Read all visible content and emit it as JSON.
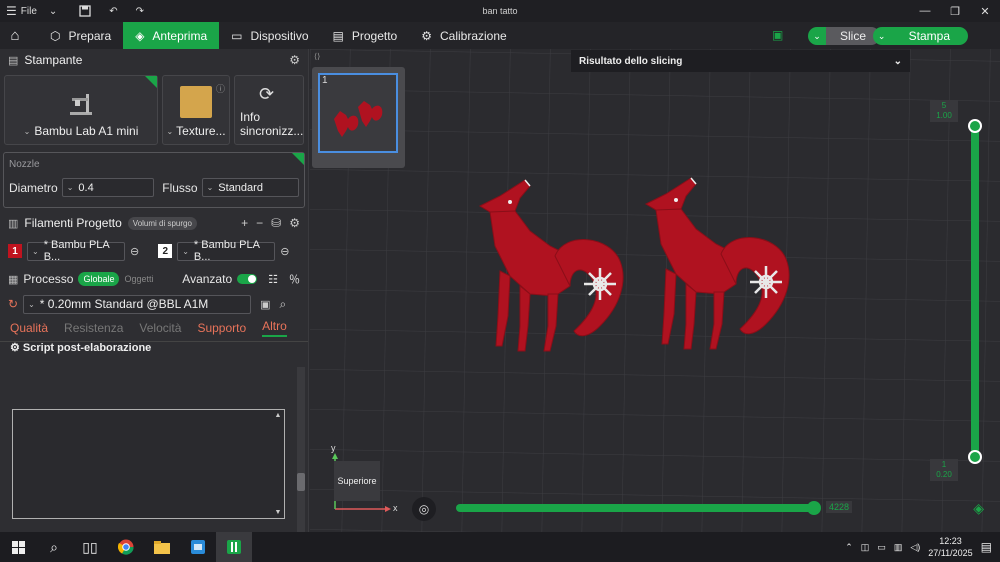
{
  "window": {
    "menu_label": "File",
    "title": "ban tatto"
  },
  "tabs": [
    {
      "label": "Prepara"
    },
    {
      "label": "Anteprima"
    },
    {
      "label": "Dispositivo"
    },
    {
      "label": "Progetto"
    },
    {
      "label": "Calibrazione"
    }
  ],
  "actions": {
    "slice_label": "Slice",
    "print_label": "Stampa"
  },
  "printer": {
    "section_title": "Stampante",
    "printer_name": "Bambu Lab A1 mini",
    "plate_label": "Texture...",
    "sync_label_1": "Info",
    "sync_label_2": "sincronizz..."
  },
  "nozzle": {
    "title": "Nozzle",
    "diameter_label": "Diametro",
    "diameter_value": "0.4",
    "flow_label": "Flusso",
    "flow_value": "Standard"
  },
  "filaments": {
    "section_title": "Filamenti Progetto",
    "purge_label": "Volumi di spurgo",
    "items": [
      {
        "index": "1",
        "name": "* Bambu PLA B...",
        "color": "#c0131f"
      },
      {
        "index": "2",
        "name": "* Bambu PLA B...",
        "color": "#ffffff"
      }
    ]
  },
  "process": {
    "section_title": "Processo",
    "global_label": "Globale",
    "objects_label": "Oggetti",
    "advanced_label": "Avanzato",
    "profile": "* 0.20mm Standard @BBL A1M",
    "subtabs": [
      "Qualità",
      "Resistenza",
      "Velocità",
      "Supporto",
      "Altro"
    ],
    "script_title": "Script post-elaborazione"
  },
  "viewport": {
    "plate_number": "1",
    "result_title": "Risultato dello slicing",
    "layer_top": [
      "5",
      "1.00"
    ],
    "layer_bottom": [
      "1",
      "0.20"
    ],
    "h_slider_value": "4228",
    "cube_label": "Superiore",
    "axis_x": "x",
    "axis_y": "y"
  },
  "taskbar": {
    "time": "12:23",
    "date": "27/11/2025"
  },
  "colors": {
    "accent": "#1aa548",
    "model": "#b01220"
  }
}
